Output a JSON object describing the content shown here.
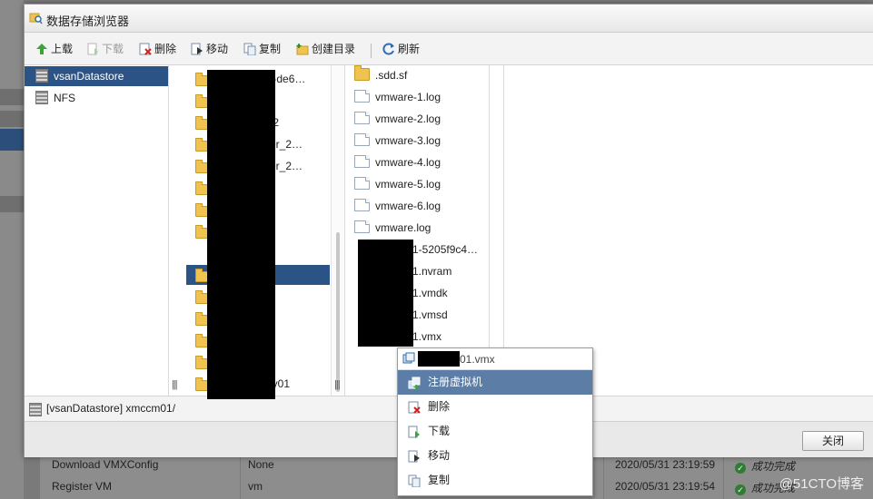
{
  "dialog": {
    "title": "数据存储浏览器",
    "toolbar": {
      "upload": "上载",
      "download": "下载",
      "delete": "删除",
      "move": "移动",
      "copy": "复制",
      "create_dir": "创建目录",
      "refresh": "刷新"
    },
    "datastores": [
      {
        "label": "vsanDatastore",
        "selected": true
      },
      {
        "label": "NFS",
        "selected": false
      }
    ],
    "folders_pane": {
      "visible_fragments": [
        "a2-de6…",
        "01",
        "002",
        "rver_2…",
        "rver_2…",
        "oxy01"
      ]
    },
    "files": [
      ".sdd.sf",
      "vmware-1.log",
      "vmware-2.log",
      "vmware-3.log",
      "vmware-4.log",
      "vmware-5.log",
      "vmware-6.log",
      "vmware.log",
      "1-5205f9c4…",
      "1.nvram",
      "1.vmdk",
      "1.vmsd",
      "1.vmx"
    ],
    "path": "[vsanDatastore] xmccm01/",
    "close_label": "关闭"
  },
  "context_menu": {
    "header": "01.vmx",
    "items": [
      "注册虚拟机",
      "删除",
      "下载",
      "移动",
      "复制"
    ],
    "highlighted": "注册虚拟机"
  },
  "background_tasks": {
    "rows": [
      {
        "name": "Download VMXConfig",
        "target": "None",
        "time": "2020/05/31 23:19:59",
        "status": "成功完成"
      },
      {
        "name": "Register VM",
        "target": "vm",
        "time": "2020/05/31 23:19:54",
        "status": "成功完成"
      }
    ]
  },
  "watermark": "@51CTO博客"
}
